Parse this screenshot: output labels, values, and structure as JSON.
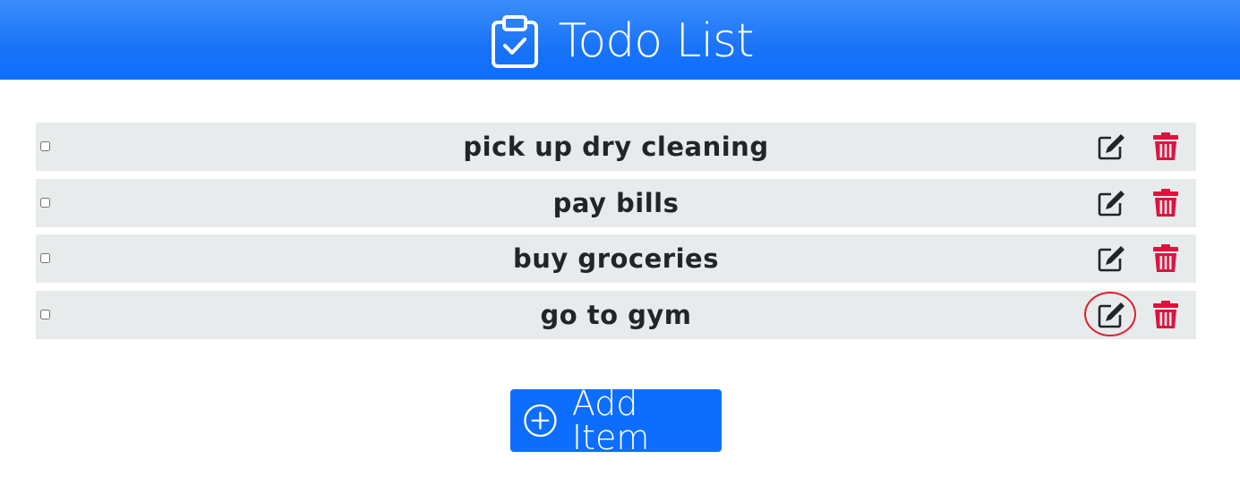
{
  "header": {
    "title": "Todo List",
    "icon": "clipboard-check-icon",
    "background": "#0d6efd"
  },
  "todos": [
    {
      "label": "pick up dry cleaning",
      "checked": false
    },
    {
      "label": "pay bills",
      "checked": false
    },
    {
      "label": "buy groceries",
      "checked": false
    },
    {
      "label": "go to gym",
      "checked": false
    }
  ],
  "icons": {
    "edit": "pencil-square-icon",
    "delete": "trash-icon",
    "add": "plus-circle-icon"
  },
  "colors": {
    "accent": "#0d6efd",
    "delete": "#dc143c",
    "row_bg": "#e8ebec",
    "highlight": "#e0202e"
  },
  "add_button": {
    "label": "Add Item"
  }
}
